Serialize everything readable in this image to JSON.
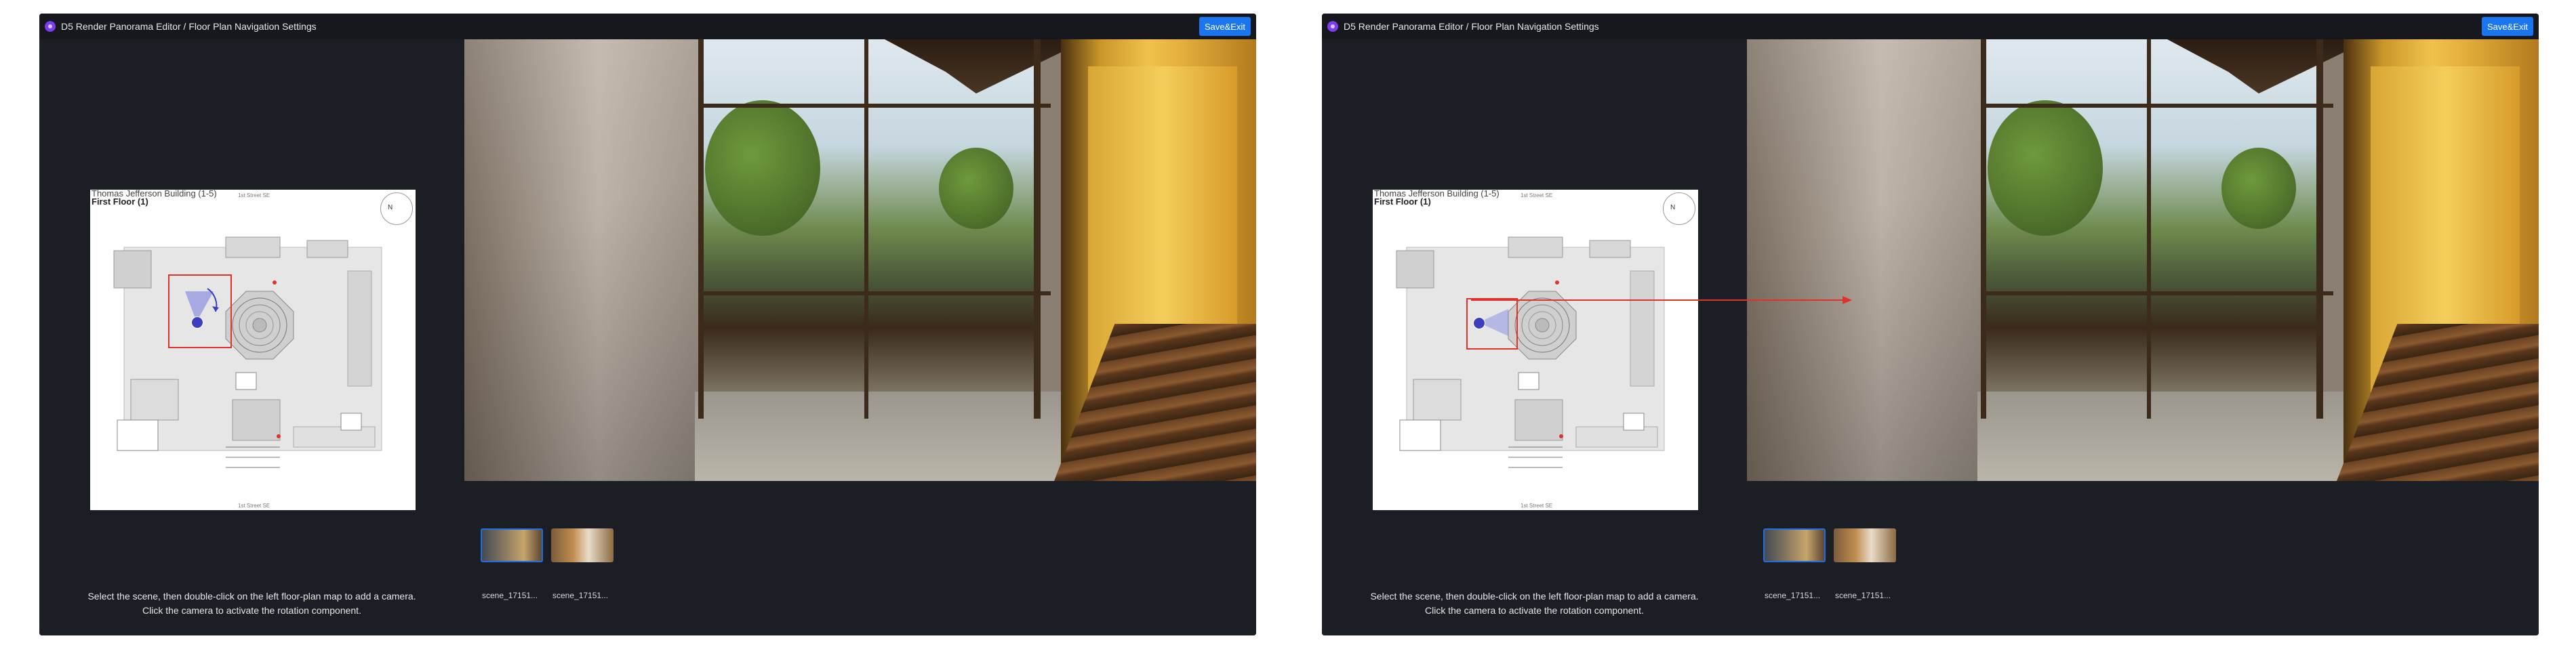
{
  "app": {
    "title": "D5 Render Panorama Editor / Floor Plan Navigation Settings",
    "save_label": "Save&Exit",
    "accent_color": "#1976f0"
  },
  "floorplan": {
    "building": "Thomas Jefferson Building (1-5)",
    "floor": "First Floor (1)",
    "street_top": "1st Street SE",
    "street_bottom": "1st Street SE",
    "north_label": "N"
  },
  "instructions": {
    "line1": "Select the scene, then double-click on the left floor-plan map to add a camera.",
    "line2": "Click the camera to activate the rotation component."
  },
  "scenes": [
    {
      "label": "scene_17151...",
      "selected": true
    },
    {
      "label": "scene_17151...",
      "selected": false
    }
  ],
  "panels": [
    {
      "state": "camera-rotating",
      "camera_highlight_color": "#e0322b"
    },
    {
      "state": "camera-linked-arrow",
      "camera_highlight_color": "#e0322b",
      "arrow_color": "#e0322b"
    }
  ]
}
